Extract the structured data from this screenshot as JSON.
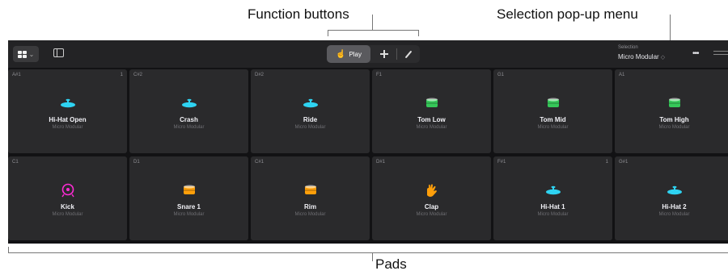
{
  "callouts": {
    "function_buttons": "Function buttons",
    "selection_menu": "Selection pop-up menu",
    "pads": "Pads"
  },
  "toolbar": {
    "view_icon": "grid-icon",
    "play_label": "Play",
    "selection_label": "Selection",
    "selection_value": "Micro Modular"
  },
  "colors": {
    "cyan": "#2ed3f2",
    "green": "#35c759",
    "magenta": "#ff2bd6",
    "orange": "#ff9f0a"
  },
  "pads": [
    {
      "note": "A#1",
      "count": "1",
      "name": "Hi-Hat Open",
      "kit": "Micro Modular",
      "icon": "cymbal-icon",
      "color": "#2ed3f2"
    },
    {
      "note": "C#2",
      "count": "",
      "name": "Crash",
      "kit": "Micro Modular",
      "icon": "cymbal-icon",
      "color": "#2ed3f2"
    },
    {
      "note": "D#2",
      "count": "",
      "name": "Ride",
      "kit": "Micro Modular",
      "icon": "cymbal-icon",
      "color": "#2ed3f2"
    },
    {
      "note": "F1",
      "count": "",
      "name": "Tom Low",
      "kit": "Micro Modular",
      "icon": "drum-icon",
      "color": "#35c759"
    },
    {
      "note": "G1",
      "count": "",
      "name": "Tom Mid",
      "kit": "Micro Modular",
      "icon": "drum-icon",
      "color": "#35c759"
    },
    {
      "note": "A1",
      "count": "",
      "name": "Tom High",
      "kit": "Micro Modular",
      "icon": "drum-icon",
      "color": "#35c759"
    },
    {
      "note": "C1",
      "count": "",
      "name": "Kick",
      "kit": "Micro Modular",
      "icon": "kick-drum-icon",
      "color": "#ff2bd6"
    },
    {
      "note": "D1",
      "count": "",
      "name": "Snare 1",
      "kit": "Micro Modular",
      "icon": "drum-icon",
      "color": "#ff9f0a"
    },
    {
      "note": "C#1",
      "count": "",
      "name": "Rim",
      "kit": "Micro Modular",
      "icon": "drum-icon",
      "color": "#ff9f0a"
    },
    {
      "note": "D#1",
      "count": "",
      "name": "Clap",
      "kit": "Micro Modular",
      "icon": "clap-icon",
      "color": "#ff9f0a"
    },
    {
      "note": "F#1",
      "count": "1",
      "name": "Hi-Hat 1",
      "kit": "Micro Modular",
      "icon": "cymbal-icon",
      "color": "#2ed3f2"
    },
    {
      "note": "G#1",
      "count": "",
      "name": "Hi-Hat 2",
      "kit": "Micro Modular",
      "icon": "cymbal-icon",
      "color": "#2ed3f2"
    }
  ]
}
